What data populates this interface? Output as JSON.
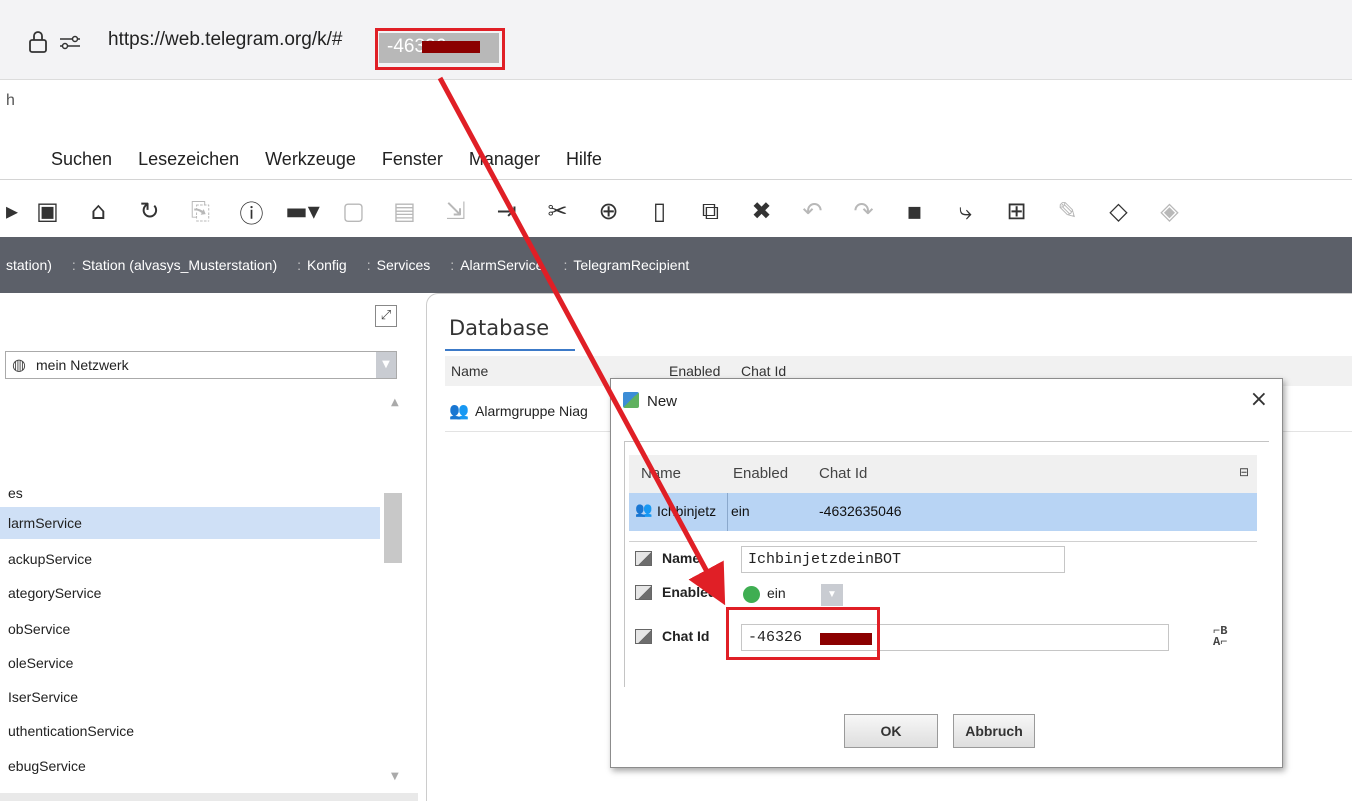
{
  "browser": {
    "url_prefix": "https://web.telegram.org/k/#",
    "url_selected_visible": "-46326",
    "lock_icon": "lock-icon",
    "permissions_icon": "tune-icon"
  },
  "window": {
    "title_fragment": "h"
  },
  "menu": {
    "items": [
      "Suchen",
      "Lesezeichen",
      "Werkzeuge",
      "Fenster",
      "Manager",
      "Hilfe"
    ]
  },
  "toolbar": {
    "icons": [
      "back-icon",
      "camera-icon",
      "home-icon",
      "refresh-icon",
      "copy-disabled-icon",
      "info-icon",
      "folder-dropdown-icon",
      "save-disabled-icon",
      "save-all-disabled-icon",
      "export-disabled-icon",
      "export-icon",
      "cut-icon",
      "copy-icon",
      "paste-icon",
      "duplicate-icon",
      "delete-icon",
      "undo-disabled-icon",
      "redo-disabled-icon",
      "camera2-icon",
      "link-icon",
      "new-icon",
      "edit-disabled-icon",
      "tag-icon",
      "tag2-disabled-icon"
    ]
  },
  "breadcrumb": {
    "items": [
      "station)",
      "Station (alvasys_Musterstation)",
      "Konfig",
      "Services",
      "AlarmService",
      "TelegramRecipient"
    ]
  },
  "left_panel": {
    "network_select": "mein Netzwerk",
    "tree_items": [
      {
        "label": "es",
        "selected": false
      },
      {
        "label": "larmService",
        "selected": true
      },
      {
        "label": "ackupService",
        "selected": false
      },
      {
        "label": "ategoryService",
        "selected": false
      },
      {
        "label": "obService",
        "selected": false
      },
      {
        "label": "oleService",
        "selected": false
      },
      {
        "label": "IserService",
        "selected": false
      },
      {
        "label": "uthenticationService",
        "selected": false
      },
      {
        "label": "ebugService",
        "selected": false
      }
    ]
  },
  "database": {
    "title": "Database",
    "columns": [
      "Name",
      "Enabled",
      "Chat Id"
    ],
    "rows": [
      {
        "name": "Alarmgruppe Niag"
      }
    ]
  },
  "dialog": {
    "title": "New",
    "close": "×",
    "grid_columns": [
      "Name",
      "Enabled",
      "Chat Id"
    ],
    "grid_row": {
      "name": "Ichbinjetz",
      "enabled": "ein",
      "chat_id": "-4632635046"
    },
    "props": {
      "name_label": "Name",
      "name_value": "IchbinjetzdeinBOT",
      "enabled_label": "Enabled",
      "enabled_value": "ein",
      "chatid_label": "Chat Id",
      "chatid_value": "-46326"
    },
    "ok": "OK",
    "cancel": "Abbruch"
  },
  "colors": {
    "highlight_red": "#e01f26",
    "breadcrumb_bg": "#5c6069",
    "selection_blue": "#b8d4f4",
    "enabled_green": "#3fae52"
  }
}
